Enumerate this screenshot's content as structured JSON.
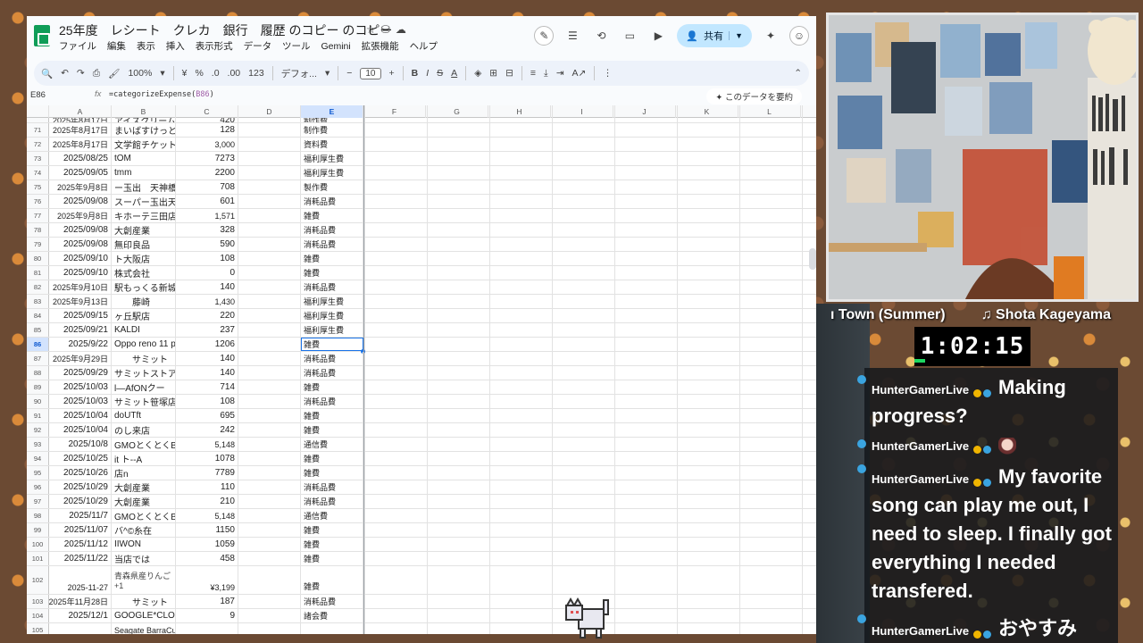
{
  "sheets": {
    "doc_title": "25年度　レシート　クレカ　銀行　履歴 のコピー のコピー",
    "menu": [
      "ファイル",
      "編集",
      "表示",
      "挿入",
      "表示形式",
      "データ",
      "ツール",
      "Gemini",
      "拡張機能",
      "ヘルプ"
    ],
    "share_label": "共有",
    "toolbar": {
      "zoom": "100%",
      "currency": "¥",
      "percent": "%",
      "dec_less": ".0",
      "dec_more": ".00",
      "number_fmt": "123",
      "font": "デフォ...",
      "font_size": "10"
    },
    "cell_ref": "E86",
    "formula_prefix": "=categorizeExpense(",
    "formula_ref": "B86",
    "formula_suffix": ")",
    "summary_button": "✦ このデータを要約",
    "columns": [
      "A",
      "B",
      "C",
      "D",
      "E",
      "F",
      "G",
      "H",
      "I",
      "J",
      "K",
      "L"
    ],
    "rows": [
      {
        "n": "",
        "a": "2025年8月17日",
        "b": "アイスクリーム",
        "c": "420",
        "e": "制作費"
      },
      {
        "n": "71",
        "a": "2025年8月17日",
        "b": "まいばすけっと",
        "c": "128",
        "e": "制作費"
      },
      {
        "n": "72",
        "a": "2025年8月17日",
        "b": "文学館チケット",
        "c": "3,000",
        "e": "資料費"
      },
      {
        "n": "73",
        "a": "2025/08/25",
        "b": "tOM",
        "c": "7273",
        "e": "福利厚生費"
      },
      {
        "n": "74",
        "a": "2025/09/05",
        "b": "tmm",
        "c": "2200",
        "e": "福利厚生費"
      },
      {
        "n": "75",
        "a": "2025年9月8日",
        "b": "ー玉出　天神橋",
        "c": "708",
        "e": "製作費"
      },
      {
        "n": "76",
        "a": "2025/09/08",
        "b": "スーパー玉出天",
        "c": "601",
        "e": "消耗品費"
      },
      {
        "n": "77",
        "a": "2025年9月8日",
        "b": "キホーテ三田店",
        "c": "1,571",
        "e": "雑費"
      },
      {
        "n": "78",
        "a": "2025/09/08",
        "b": "大創産業",
        "c": "328",
        "e": "消耗品費"
      },
      {
        "n": "79",
        "a": "2025/09/08",
        "b": "無印良品",
        "c": "590",
        "e": "消耗品費"
      },
      {
        "n": "80",
        "a": "2025/09/10",
        "b": "ト大阪店",
        "c": "108",
        "e": "雑費"
      },
      {
        "n": "81",
        "a": "2025/09/10",
        "b": "株式会社",
        "c": "0",
        "e": "雑費"
      },
      {
        "n": "82",
        "a": "2025年9月10日",
        "b": "駅もっくる新城",
        "c": "140",
        "e": "消耗品費"
      },
      {
        "n": "83",
        "a": "2025年9月13日",
        "b": "　　藤崎",
        "c": "1,430",
        "e": "福利厚生費"
      },
      {
        "n": "84",
        "a": "2025/09/15",
        "b": "ヶ丘駅店",
        "c": "220",
        "e": "福利厚生費"
      },
      {
        "n": "85",
        "a": "2025/09/21",
        "b": "KALDI",
        "c": "237",
        "e": "福利厚生費"
      },
      {
        "n": "86",
        "a": "2025/9/22",
        "b": "Oppo reno 11 p",
        "c": "1206",
        "e": "雑費"
      },
      {
        "n": "87",
        "a": "2025年9月29日",
        "b": "　　サミット",
        "c": "140",
        "e": "消耗品費"
      },
      {
        "n": "88",
        "a": "2025/09/29",
        "b": "サミットストア",
        "c": "140",
        "e": "消耗品費"
      },
      {
        "n": "89",
        "a": "2025/10/03",
        "b": "l—AfONクー",
        "c": "714",
        "e": "雑費"
      },
      {
        "n": "90",
        "a": "2025/10/03",
        "b": "サミット笹塚店",
        "c": "108",
        "e": "消耗品費"
      },
      {
        "n": "91",
        "a": "2025/10/04",
        "b": "doUTft",
        "c": "695",
        "e": "雑費"
      },
      {
        "n": "92",
        "a": "2025/10/04",
        "b": "のし来店",
        "c": "242",
        "e": "雑費"
      },
      {
        "n": "93",
        "a": "2025/10/8",
        "b": "GMOとくとくB",
        "c": "5,148",
        "e": "通信費"
      },
      {
        "n": "94",
        "a": "2025/10/25",
        "b": "it ト--A",
        "c": "1078",
        "e": "雑費"
      },
      {
        "n": "95",
        "a": "2025/10/26",
        "b": "店n",
        "c": "7789",
        "e": "雑費"
      },
      {
        "n": "96",
        "a": "2025/10/29",
        "b": "大創産業",
        "c": "110",
        "e": "消耗品費"
      },
      {
        "n": "97",
        "a": "2025/10/29",
        "b": "大創産業",
        "c": "210",
        "e": "消耗品費"
      },
      {
        "n": "98",
        "a": "2025/11/7",
        "b": "GMOとくとくB",
        "c": "5,148",
        "e": "通信費"
      },
      {
        "n": "99",
        "a": "2025/11/07",
        "b": "バ^©糸在",
        "c": "1150",
        "e": "雑費"
      },
      {
        "n": "100",
        "a": "2025/11/12",
        "b": "IIWON",
        "c": "1059",
        "e": "雑費"
      },
      {
        "n": "101",
        "a": "2025/11/22",
        "b": "当店では",
        "c": "458",
        "e": "雑費"
      },
      {
        "n": "102",
        "a": "2025-11-27",
        "b": "青森県産りんご",
        "b2": "+1",
        "c": "¥3,199",
        "e": "雑費"
      },
      {
        "n": "103",
        "a": "2025年11月28日",
        "b": "　　サミット",
        "c": "187",
        "e": "消耗品費"
      },
      {
        "n": "104",
        "a": "2025/12/1",
        "b": "GOOGLE*CLO",
        "c": "9",
        "e": "諸会費"
      },
      {
        "n": "105",
        "a": "",
        "b": "Seagate BarraCu",
        "c": "",
        "e": ""
      }
    ]
  },
  "stream": {
    "now_playing_left": "ı Town (Summer)",
    "now_playing_right": "♫ Shota Kageyama",
    "timer": "1:02:15",
    "chat": [
      {
        "user": "HunterGamerLive",
        "text": "Making progress?"
      },
      {
        "user": "HunterGamerLive",
        "text": ""
      },
      {
        "user": "HunterGamerLive",
        "text": "My favorite song can play me out, I need to sleep. I finally got everything I needed transfered."
      },
      {
        "user": "HunterGamerLive",
        "text": "おやすみ"
      }
    ]
  },
  "colors": {
    "sheets_green": "#0f9d58",
    "share_bg": "#c2e7ff",
    "selection_blue": "#1a73e8",
    "timer_green": "#1ed760"
  }
}
